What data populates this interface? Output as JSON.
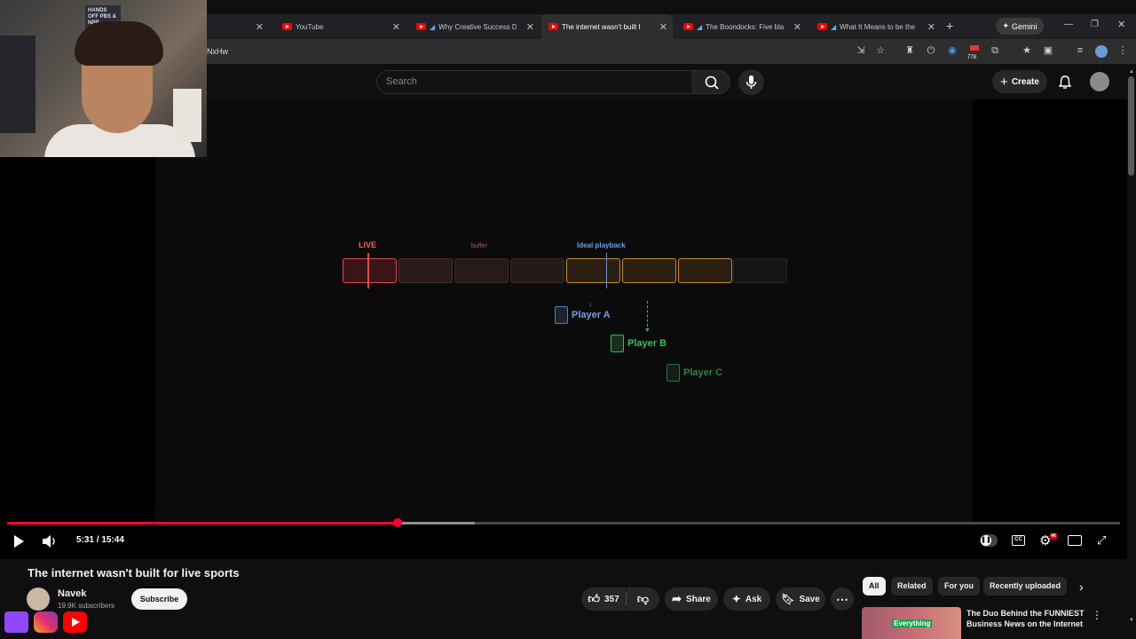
{
  "browser": {
    "tabs": [
      {
        "title": "YouTube"
      },
      {
        "title": "Why Creative Success De"
      },
      {
        "title": "The internet wasn't built for l"
      },
      {
        "title": "The Boondocks: Five blac"
      },
      {
        "title": "What It Means to be the"
      }
    ],
    "new_tab": "+",
    "gemini_label": "Gemini",
    "url_fragment": "NxHw",
    "extension_badge": "778"
  },
  "youtube": {
    "search_placeholder": "Search",
    "create_label": "Create"
  },
  "video": {
    "diagram": {
      "live_label": "LIVE",
      "buffer_label": "buffer",
      "ideal_label": "Ideal playback",
      "players": [
        "Player A",
        "Player B",
        "Player C"
      ]
    },
    "time": "5:31 / 15:44",
    "progress_played": 0.351,
    "progress_buffered": 0.42,
    "settings_badge": "4K"
  },
  "meta": {
    "title": "The internet wasn't built for live sports",
    "channel": "Navek",
    "subscribers": "19.9K subscribers",
    "subscribe_label": "Subscribe",
    "likes": "357",
    "share_label": "Share",
    "ask_label": "Ask",
    "save_label": "Save"
  },
  "sidebar": {
    "chips": [
      "All",
      "Related",
      "For you",
      "Recently uploaded"
    ],
    "first_video_title": "The Duo Behind the FUNNIEST Business News on the Internet",
    "first_video_thumb_text": "Everything"
  },
  "webcam": {
    "sign_text": "HANDS OFF PBS & NPR"
  },
  "colors": {
    "live_red": "#ff4d4d",
    "ideal_blue": "#5b8fe0",
    "player_a": "#6f9fe8",
    "player_b": "#2fbf5a",
    "player_c": "#2f7f4a",
    "progress_red": "#ff0033"
  }
}
